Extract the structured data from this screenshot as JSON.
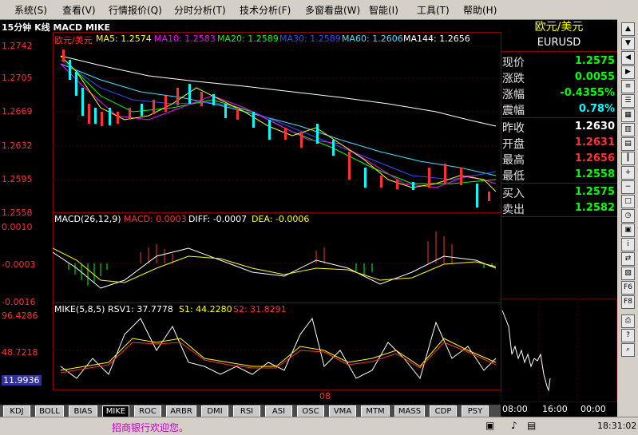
{
  "menu": [
    "系统(S)",
    "查看(V)",
    "行情报价(Q)",
    "分时分析(T)",
    "技术分析(F)",
    "多窗看盘(W)",
    "智能(I)",
    "工具(T)",
    "帮助(H)"
  ],
  "chart_header": "15分钟 K线 MACD MIKE",
  "price_panel": {
    "symbol_label": "欧元/美元",
    "ma": [
      {
        "label": "MA5: 1.2574",
        "color": "#ffff00"
      },
      {
        "label": "MA10: 1.2583",
        "color": "#ff00ff"
      },
      {
        "label": "MA20: 1.2589",
        "color": "#00ff00"
      },
      {
        "label": "MA30: 1.2589",
        "color": "#3050ff"
      },
      {
        "label": "MA60: 1.2606",
        "color": "#40e0ff"
      },
      {
        "label": "MA144: 1.2656",
        "color": "#ffffff"
      }
    ],
    "axis": [
      "1.2742",
      "1.2705",
      "1.2669",
      "1.2632",
      "1.2595",
      "1.2558"
    ]
  },
  "macd_panel": {
    "title": "MACD(26,12,9)",
    "macd": "MACD: 0.0003",
    "diff": "DIFF: -0.0007",
    "dea": "DEA: -0.0006",
    "axis": [
      "0.0010",
      "-0.0003",
      "-0.0016"
    ]
  },
  "mike_panel": {
    "title": "MIKE(5,8,5)",
    "rsv": "RSV1: 37.7778",
    "s1": "S1: 44.2280",
    "s2": "S2: 31.8291",
    "axis": [
      "96.4286",
      "48.7218",
      "11.9936"
    ]
  },
  "x_tick": "08",
  "quote": {
    "title": "欧元/美元",
    "code": "EURUSD",
    "rows": [
      {
        "k": "现价",
        "v": "1.2575",
        "c": "#00ff00"
      },
      {
        "k": "涨跌",
        "v": "0.0055",
        "c": "#00ff00"
      },
      {
        "k": "涨幅",
        "v": "-0.4355%",
        "c": "#00ff00"
      },
      {
        "k": "震幅",
        "v": "0.78%",
        "c": "#00ffff"
      },
      {
        "k": "昨收",
        "v": "1.2630",
        "c": "#ffffff"
      },
      {
        "k": "开盘",
        "v": "1.2631",
        "c": "#ff3030"
      },
      {
        "k": "最高",
        "v": "1.2656",
        "c": "#ff3030"
      },
      {
        "k": "最低",
        "v": "1.2558",
        "c": "#00ff00"
      },
      {
        "k": "买入",
        "v": "1.2575",
        "c": "#00ff00"
      },
      {
        "k": "卖出",
        "v": "1.2582",
        "c": "#00ff00"
      }
    ],
    "time_labels": [
      "08:00",
      "16:00",
      "00:00"
    ]
  },
  "tabs": [
    "KDJ",
    "BOLL",
    "BIAS",
    "MIKE",
    "ROC",
    "ARBR",
    "DMI",
    "RSI",
    "ASI",
    "OSC",
    "VMA",
    "MTM",
    "MASS",
    "CDP",
    "PSY"
  ],
  "active_tab": "MIKE",
  "status": {
    "ticker": "招商银行欢迎您。",
    "time": "18:31:02"
  },
  "toolbar_icons": [
    "minimize-icon",
    "restore-icon",
    "close-icon",
    "arrow-up-icon",
    "arrow-down-icon",
    "arrow-left-icon",
    "arrow-right-icon",
    "news-icon",
    "list-icon",
    "grid-icon",
    "chart-icon",
    "table-icon",
    "candle-icon",
    "zoom-in-icon",
    "zoom-out-icon",
    "window-icon",
    "clock-icon",
    "save-icon",
    "info-icon",
    "compare-icon",
    "stats-icon",
    "f6-icon",
    "f8-icon",
    "print-icon",
    "help-icon",
    "search-icon"
  ]
}
